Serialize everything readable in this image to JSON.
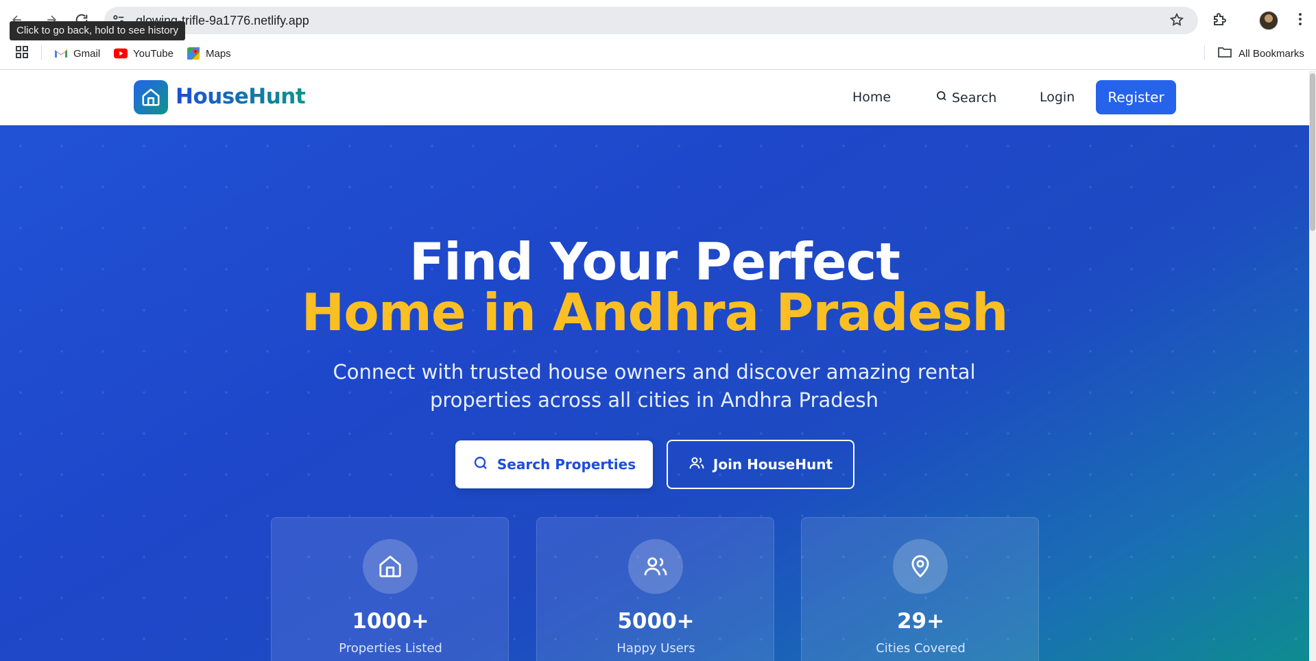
{
  "browser": {
    "url": "glowing-trifle-9a1776.netlify.app",
    "tooltip": "Click to go back, hold to see history",
    "bookmarks": [
      {
        "label": "Gmail",
        "icon": "gmail-icon"
      },
      {
        "label": "YouTube",
        "icon": "youtube-icon"
      },
      {
        "label": "Maps",
        "icon": "maps-icon"
      }
    ],
    "all_bookmarks_label": "All Bookmarks"
  },
  "header": {
    "brand": "HouseHunt",
    "nav": {
      "home": "Home",
      "search": "Search",
      "login": "Login",
      "register": "Register"
    }
  },
  "hero": {
    "title_line1": "Find Your Perfect",
    "title_line2": "Home in Andhra Pradesh",
    "subtitle": "Connect with trusted house owners and discover amazing rental properties across all cities in Andhra Pradesh",
    "primary_cta": "Search Properties",
    "secondary_cta": "Join HouseHunt"
  },
  "stats": [
    {
      "value": "1000+",
      "label": "Properties Listed",
      "icon": "home-icon"
    },
    {
      "value": "5000+",
      "label": "Happy Users",
      "icon": "users-icon"
    },
    {
      "value": "29+",
      "label": "Cities Covered",
      "icon": "map-pin-icon"
    }
  ],
  "colors": {
    "brand_blue": "#2563eb",
    "accent_yellow": "#fbbf24",
    "brand_teal": "#0d9488"
  }
}
